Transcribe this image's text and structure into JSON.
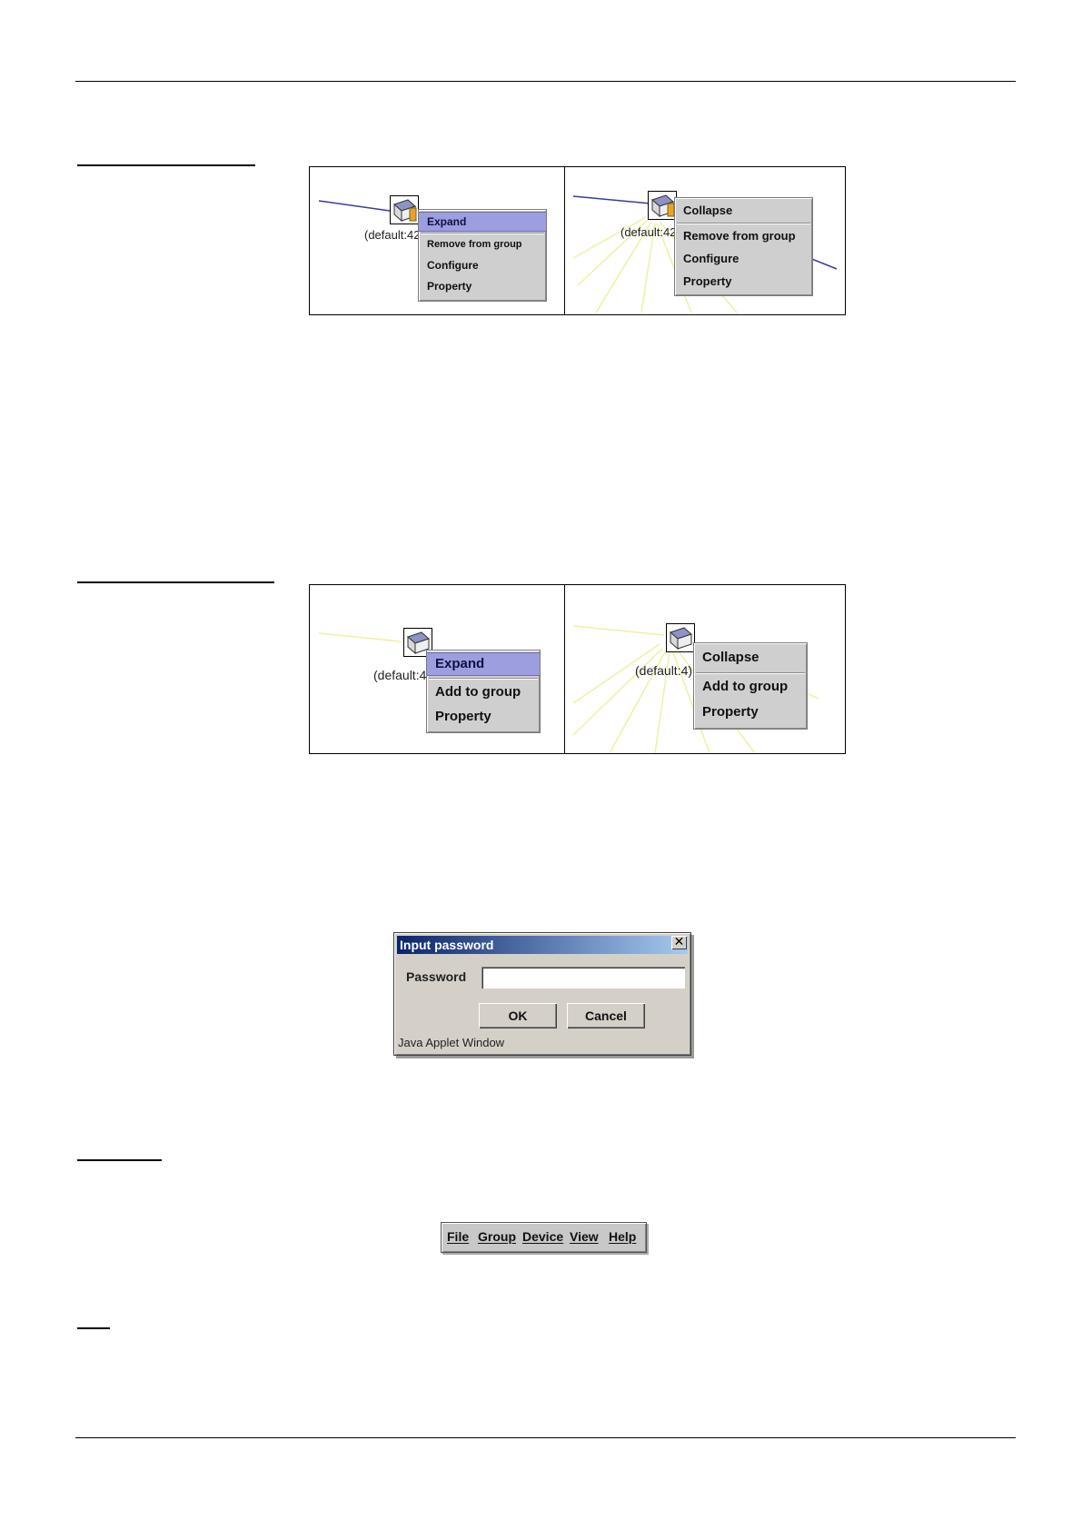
{
  "figure1": {
    "left_panel": {
      "device_label": "(default:42",
      "menu": [
        "Expand",
        "Remove from group",
        "Configure",
        "Property"
      ],
      "selected": "Expand"
    },
    "right_panel": {
      "device_label": "(default:42",
      "menu": [
        "Collapse",
        "Remove from group",
        "Configure",
        "Property"
      ]
    }
  },
  "figure2": {
    "left_panel": {
      "device_label": "(default:4",
      "menu": [
        "Expand",
        "Add to group",
        "Property"
      ],
      "selected": "Expand"
    },
    "right_panel": {
      "device_label": "(default:4)",
      "menu": [
        "Collapse",
        "Add to group",
        "Property"
      ]
    }
  },
  "dialog": {
    "title": "Input password",
    "close_glyph": "✕",
    "password_label": "Password",
    "password_value": "",
    "ok": "OK",
    "cancel": "Cancel",
    "status": "Java Applet Window"
  },
  "menubar": [
    "File",
    "Group",
    "Device",
    "View",
    "Help"
  ],
  "colors": {
    "menu_bg": "#cfcfcf",
    "menu_selected": "#9c9ee0",
    "link_blue": "#3a3aa0",
    "link_yellow": "#f0f0a0",
    "title_gradient_start": "#0a246a"
  }
}
